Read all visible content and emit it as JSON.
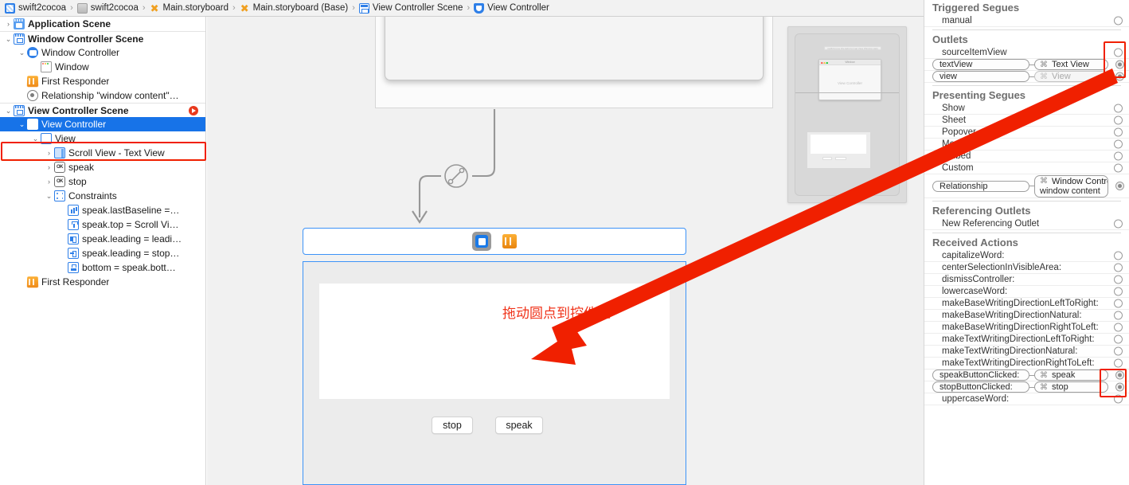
{
  "breadcrumb": {
    "items": [
      {
        "label": "swift2cocoa",
        "icon": "project-icon"
      },
      {
        "label": "swift2cocoa",
        "icon": "target-icon"
      },
      {
        "label": "Main.storyboard",
        "icon": "storyboard-icon"
      },
      {
        "label": "Main.storyboard (Base)",
        "icon": "storyboard-icon"
      },
      {
        "label": "View Controller Scene",
        "icon": "scene-icon"
      },
      {
        "label": "View Controller",
        "icon": "view-controller-icon"
      }
    ],
    "separator": "›",
    "back_arrow": "‹",
    "forward_arrow": "›",
    "issue_icon": "warning-triangle-icon"
  },
  "outline": {
    "rows": [
      {
        "label": "Application Scene",
        "indent": 0,
        "disclosure": "›",
        "icon": "application-scene-icon",
        "bold": true,
        "selected": false,
        "separator_above": false,
        "scene_arrow": false
      },
      {
        "label": "Window Controller Scene",
        "indent": 0,
        "disclosure": "⌄",
        "icon": "scene-icon",
        "bold": true,
        "selected": false,
        "separator_above": true,
        "scene_arrow": false
      },
      {
        "label": "Window Controller",
        "indent": 1,
        "disclosure": "⌄",
        "icon": "window-controller-icon",
        "bold": false,
        "selected": false,
        "separator_above": false,
        "scene_arrow": false
      },
      {
        "label": "Window",
        "indent": 2,
        "disclosure": "",
        "icon": "window-icon",
        "bold": false,
        "selected": false,
        "separator_above": false,
        "scene_arrow": false
      },
      {
        "label": "First Responder",
        "indent": 1,
        "disclosure": "",
        "icon": "first-responder-icon",
        "bold": false,
        "selected": false,
        "separator_above": false,
        "scene_arrow": false
      },
      {
        "label": "Relationship \"window content\"…",
        "indent": 1,
        "disclosure": "",
        "icon": "relationship-icon",
        "bold": false,
        "selected": false,
        "separator_above": false,
        "scene_arrow": false
      },
      {
        "label": "View Controller Scene",
        "indent": 0,
        "disclosure": "⌄",
        "icon": "scene-icon",
        "bold": true,
        "selected": false,
        "separator_above": true,
        "scene_arrow": true
      },
      {
        "label": "View Controller",
        "indent": 1,
        "disclosure": "⌄",
        "icon": "view-controller-square-icon",
        "bold": false,
        "selected": true,
        "separator_above": false,
        "scene_arrow": false
      },
      {
        "label": "View",
        "indent": 2,
        "disclosure": "⌄",
        "icon": "view-icon",
        "bold": false,
        "selected": false,
        "separator_above": false,
        "scene_arrow": false
      },
      {
        "label": "Scroll View - Text View",
        "indent": 3,
        "disclosure": "›",
        "icon": "scroll-view-icon",
        "bold": false,
        "selected": false,
        "separator_above": false,
        "scene_arrow": false
      },
      {
        "label": "speak",
        "indent": 3,
        "disclosure": "›",
        "icon": "button-icon",
        "bold": false,
        "selected": false,
        "separator_above": false,
        "scene_arrow": false
      },
      {
        "label": "stop",
        "indent": 3,
        "disclosure": "›",
        "icon": "button-icon",
        "bold": false,
        "selected": false,
        "separator_above": false,
        "scene_arrow": false
      },
      {
        "label": "Constraints",
        "indent": 3,
        "disclosure": "⌄",
        "icon": "constraints-icon",
        "bold": false,
        "selected": false,
        "separator_above": false,
        "scene_arrow": false
      },
      {
        "label": "speak.lastBaseline =…",
        "indent": 4,
        "disclosure": "",
        "icon": "constraint-baseline-icon",
        "bold": false,
        "selected": false,
        "separator_above": false,
        "scene_arrow": false
      },
      {
        "label": "speak.top = Scroll Vi…",
        "indent": 4,
        "disclosure": "",
        "icon": "constraint-top-icon",
        "bold": false,
        "selected": false,
        "separator_above": false,
        "scene_arrow": false
      },
      {
        "label": "speak.leading = leadi…",
        "indent": 4,
        "disclosure": "",
        "icon": "constraint-leading-icon",
        "bold": false,
        "selected": false,
        "separator_above": false,
        "scene_arrow": false
      },
      {
        "label": "speak.leading = stop…",
        "indent": 4,
        "disclosure": "",
        "icon": "constraint-horiz-icon",
        "bold": false,
        "selected": false,
        "separator_above": false,
        "scene_arrow": false
      },
      {
        "label": "bottom = speak.bott…",
        "indent": 4,
        "disclosure": "",
        "icon": "constraint-bottom-icon",
        "bold": false,
        "selected": false,
        "separator_above": false,
        "scene_arrow": false
      },
      {
        "label": "First Responder",
        "indent": 1,
        "disclosure": "",
        "icon": "first-responder-icon",
        "bold": false,
        "selected": false,
        "separator_above": false,
        "scene_arrow": false
      }
    ]
  },
  "canvas": {
    "dock": {
      "view_controller_icon": "view-controller-icon",
      "first_responder_icon": "first-responder-icon"
    },
    "hint_text": "拖动圆点到控件上",
    "hint_color": "#f0331a",
    "buttons": [
      {
        "label": "stop"
      },
      {
        "label": "speak"
      }
    ],
    "minimap": {
      "window_title": "Window",
      "view_controller_label": "View Controller",
      "menu_items": "swift2cocoa  File  Edit  Format  View  Window  Help"
    }
  },
  "inspector": {
    "sections": [
      {
        "title": "Triggered Segues",
        "rows": [
          {
            "type": "plain",
            "label": "manual",
            "connected": false
          }
        ]
      },
      {
        "title": "Outlets",
        "rows": [
          {
            "type": "plain",
            "label": "sourceItemView",
            "connected": false
          },
          {
            "type": "connected",
            "left": "textView",
            "right": "Text View",
            "modifier": "⌘",
            "connected": true,
            "dim": false
          },
          {
            "type": "connected",
            "left": "view",
            "right": "View",
            "modifier": "⌘",
            "connected": true,
            "dim": true
          }
        ]
      },
      {
        "title": "Presenting Segues",
        "rows": [
          {
            "type": "plain",
            "label": "Show",
            "connected": false
          },
          {
            "type": "plain",
            "label": "Sheet",
            "connected": false
          },
          {
            "type": "plain",
            "label": "Popover",
            "connected": false
          },
          {
            "type": "plain",
            "label": "Modal",
            "connected": false
          },
          {
            "type": "plain",
            "label": "Embed",
            "connected": false
          },
          {
            "type": "plain",
            "label": "Custom",
            "connected": false
          },
          {
            "type": "connected2",
            "left": "Relationship",
            "right": "Window Contro…",
            "right2": "window content",
            "modifier": "⌘",
            "connected": true,
            "dim": false
          }
        ]
      },
      {
        "title": "Referencing Outlets",
        "rows": [
          {
            "type": "plain",
            "label": "New Referencing Outlet",
            "connected": false
          }
        ]
      },
      {
        "title": "Received Actions",
        "rows": [
          {
            "type": "plain",
            "label": "capitalizeWord:",
            "connected": false
          },
          {
            "type": "plain",
            "label": "centerSelectionInVisibleArea:",
            "connected": false
          },
          {
            "type": "plain",
            "label": "dismissController:",
            "connected": false
          },
          {
            "type": "plain",
            "label": "lowercaseWord:",
            "connected": false
          },
          {
            "type": "plain",
            "label": "makeBaseWritingDirectionLeftToRight:",
            "connected": false
          },
          {
            "type": "plain",
            "label": "makeBaseWritingDirectionNatural:",
            "connected": false
          },
          {
            "type": "plain",
            "label": "makeBaseWritingDirectionRightToLeft:",
            "connected": false
          },
          {
            "type": "plain",
            "label": "makeTextWritingDirectionLeftToRight:",
            "connected": false
          },
          {
            "type": "plain",
            "label": "makeTextWritingDirectionNatural:",
            "connected": false
          },
          {
            "type": "plain",
            "label": "makeTextWritingDirectionRightToLeft:",
            "connected": false
          },
          {
            "type": "connected",
            "left": "speakButtonClicked:",
            "right": "speak",
            "modifier": "⌘",
            "connected": true,
            "dim": false
          },
          {
            "type": "connected",
            "left": "stopButtonClicked:",
            "right": "stop",
            "modifier": "⌘",
            "connected": true,
            "dim": false
          },
          {
            "type": "plain",
            "label": "uppercaseWord:",
            "connected": false
          }
        ]
      }
    ]
  },
  "annotations": {
    "arrow_color": "#f02000",
    "highlight_color": "#f02000"
  }
}
